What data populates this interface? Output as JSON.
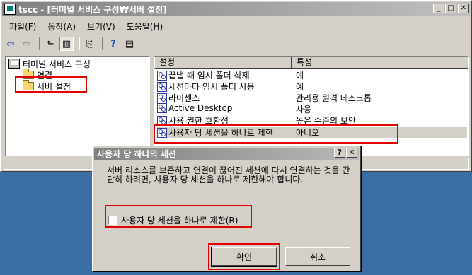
{
  "window": {
    "title": "tscc - [터미널 서비스 구성₩서버 설정]",
    "controls": {
      "minimize": "_",
      "maximize": "□",
      "close": "✕"
    }
  },
  "menu": [
    "파일(F)",
    "동작(A)",
    "보기(V)",
    "도움말(H)"
  ],
  "toolbar": [
    {
      "icon": "back-arrow-icon",
      "glyph": "⇦"
    },
    {
      "icon": "forward-arrow-icon",
      "glyph": "⇨"
    },
    {
      "icon": "up-folder-icon",
      "glyph": "⬑"
    },
    {
      "icon": "show-hide-tree-icon",
      "glyph": "▥"
    },
    {
      "icon": "export-list-icon",
      "glyph": "⎘"
    },
    {
      "icon": "help-icon",
      "glyph": "?"
    },
    {
      "icon": "properties-icon",
      "glyph": "▤"
    }
  ],
  "tree": {
    "root": "터미널 서비스 구성",
    "items": [
      "연결",
      "서버 설정"
    ]
  },
  "list": {
    "columns": [
      "설정",
      "특성"
    ],
    "rows": [
      {
        "setting": "끝낼 때 임시 폴더 삭제",
        "value": "예"
      },
      {
        "setting": "세션마다 임시 폴더 사용",
        "value": "예"
      },
      {
        "setting": "라이센스",
        "value": "관리용 원격 데스크톱"
      },
      {
        "setting": "Active Desktop",
        "value": "사용"
      },
      {
        "setting": "사용 권한 호환성",
        "value": "높은 수준의 보안"
      },
      {
        "setting": "사용자 당 세션을 하나로 제한",
        "value": "아니오"
      }
    ]
  },
  "dialog": {
    "title": "사용자 당 하나의 세션",
    "help": "?",
    "close": "✕",
    "description": "서버 리소스를 보존하고 연결이 끊어진 세션에 다시 연결하는 것을 간단히 하려면, 사용자 당 세션을 하나로 제한해야 합니다.",
    "checkbox_label": "사용자 당 세션을 하나로 제한(R)",
    "ok": "확인",
    "cancel": "취소"
  },
  "colors": {
    "highlight": "#e00000",
    "desktop": "#3a6ea5"
  }
}
